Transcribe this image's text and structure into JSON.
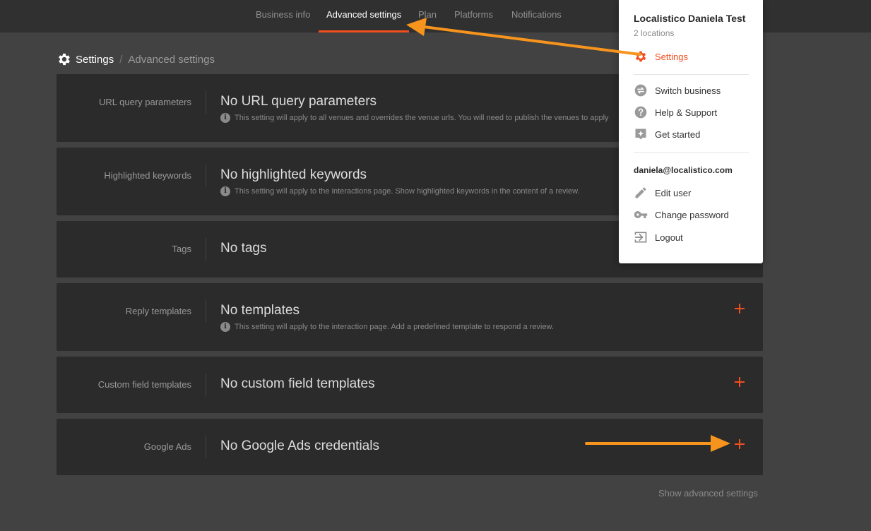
{
  "nav": {
    "tabs": [
      {
        "label": "Business info"
      },
      {
        "label": "Advanced settings"
      },
      {
        "label": "Plan"
      },
      {
        "label": "Platforms"
      },
      {
        "label": "Notifications"
      }
    ],
    "active_index": 1
  },
  "breadcrumb": {
    "current": "Settings",
    "separator": "/",
    "page": "Advanced settings"
  },
  "sections": [
    {
      "label": "URL query parameters",
      "title": "No URL query parameters",
      "note": "This setting will apply to all venues and overrides the venue urls. You will need to publish the venues to apply"
    },
    {
      "label": "Highlighted keywords",
      "title": "No highlighted keywords",
      "note": "This setting will apply to the interactions page. Show highlighted keywords in the content of a review."
    },
    {
      "label": "Tags",
      "title": "No tags"
    },
    {
      "label": "Reply templates",
      "title": "No templates",
      "note": "This setting will apply to the interaction page. Add a predefined template to respond a review."
    },
    {
      "label": "Custom field templates",
      "title": "No custom field templates"
    },
    {
      "label": "Google Ads",
      "title": "No Google Ads credentials"
    }
  ],
  "show_advanced": "Show advanced settings",
  "menu": {
    "business_name": "Localistico Daniela Test",
    "locations": "2 locations",
    "settings": "Settings",
    "switch_business": "Switch business",
    "help_support": "Help & Support",
    "get_started": "Get started",
    "email": "daniela@localistico.com",
    "edit_user": "Edit user",
    "change_password": "Change password",
    "logout": "Logout"
  },
  "colors": {
    "accent": "#f24e1e",
    "annotation_arrow": "#f7941d",
    "background": "#424242",
    "card": "#2b2b2b",
    "nav": "#303030"
  }
}
